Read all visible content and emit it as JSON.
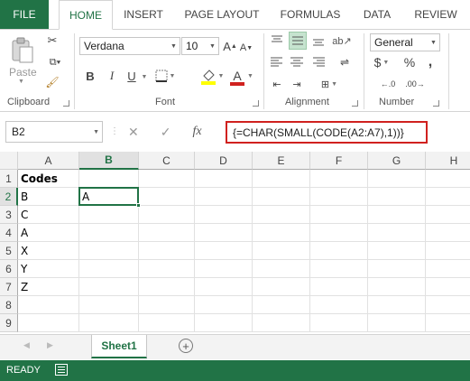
{
  "ribbon": {
    "tabs": [
      "FILE",
      "HOME",
      "INSERT",
      "PAGE LAYOUT",
      "FORMULAS",
      "DATA",
      "REVIEW"
    ],
    "active_tab": "HOME",
    "clipboard": {
      "label": "Clipboard",
      "paste_label": "Paste"
    },
    "font": {
      "label": "Font",
      "family": "Verdana",
      "size": "10",
      "bold": "B",
      "italic": "I",
      "underline": "U",
      "grow": "A",
      "shrink": "A",
      "color_letter": "A"
    },
    "alignment": {
      "label": "Alignment"
    },
    "number": {
      "label": "Number",
      "format": "General",
      "currency": "$",
      "percent": "%",
      "comma": ","
    }
  },
  "formula_bar": {
    "name_box": "B2",
    "cancel_icon": "✕",
    "enter_icon": "✓",
    "fx": "fx",
    "formula": "{=CHAR(SMALL(CODE(A2:A7),1))}"
  },
  "grid": {
    "columns": [
      "A",
      "B",
      "C",
      "D",
      "E",
      "F",
      "G",
      "H"
    ],
    "selected_column": "B",
    "rows": [
      "1",
      "2",
      "3",
      "4",
      "5",
      "6",
      "7",
      "8",
      "9"
    ],
    "selected_row": "2",
    "cells": {
      "A1": "Codes",
      "A2": "B",
      "A3": "C",
      "A4": "A",
      "A5": "X",
      "A6": "Y",
      "A7": "Z",
      "B2": "A"
    }
  },
  "sheets": {
    "tabs": [
      "Sheet1"
    ],
    "active": "Sheet1",
    "add_icon": "+"
  },
  "status": {
    "text": "READY"
  },
  "colors": {
    "excel_green": "#217346",
    "highlight_red": "#d0211f"
  }
}
